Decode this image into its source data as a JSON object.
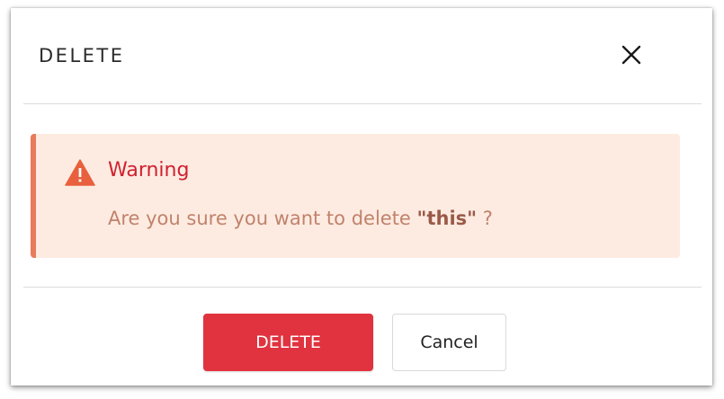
{
  "dialog": {
    "title": "DELETE",
    "close_icon": "close-icon"
  },
  "alert": {
    "icon": "warning-triangle-icon",
    "title": "Warning",
    "message_prefix": "Are you sure you want to delete ",
    "message_target": "\"this\"",
    "message_suffix": " ?"
  },
  "footer": {
    "delete_label": "DELETE",
    "cancel_label": "Cancel"
  },
  "colors": {
    "delete_button": "#e0333f",
    "alert_background": "#fdebe1",
    "alert_border": "#e87a5d",
    "warning_title": "#cf2130",
    "warning_icon": "#e8603d"
  }
}
